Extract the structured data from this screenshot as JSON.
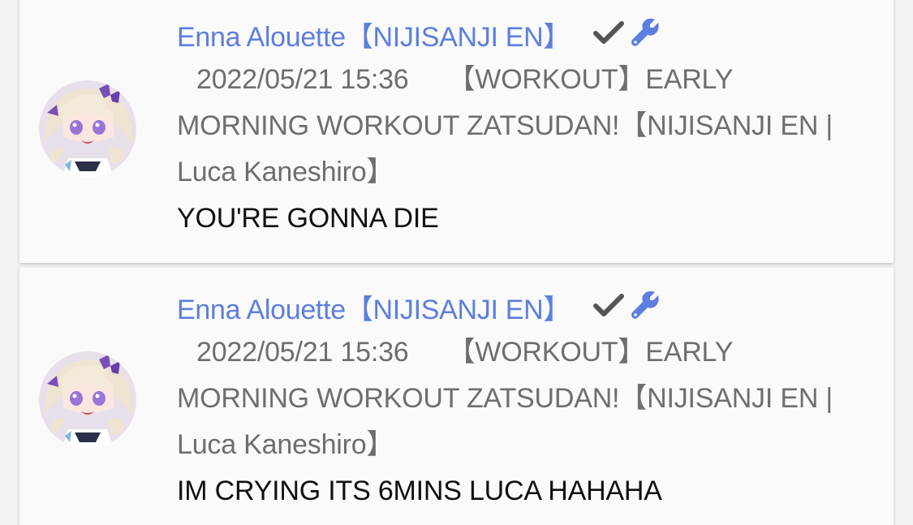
{
  "comments": [
    {
      "author": "Enna Alouette【NIJISANJI EN】",
      "timestamp": "2022/05/21 15:36",
      "video_title": "【WORKOUT】EARLY MORNING WORKOUT ZATSUDAN!【NIJISANJI EN | Luca Kaneshiro】",
      "message": "YOU'RE GONNA DIE",
      "badges": [
        "check-icon",
        "wrench-icon"
      ]
    },
    {
      "author": "Enna Alouette【NIJISANJI EN】",
      "timestamp": "2022/05/21 15:36",
      "video_title": "【WORKOUT】EARLY MORNING WORKOUT ZATSUDAN!【NIJISANJI EN | Luca Kaneshiro】",
      "message": "IM CRYING ITS 6MINS LUCA HAHAHA",
      "badges": [
        "check-icon",
        "wrench-icon"
      ]
    }
  ],
  "colors": {
    "author": "#5c7ee0",
    "meta": "#6e6e6e",
    "message": "#111111",
    "check": "#555555",
    "wrench": "#5c7ee0"
  }
}
